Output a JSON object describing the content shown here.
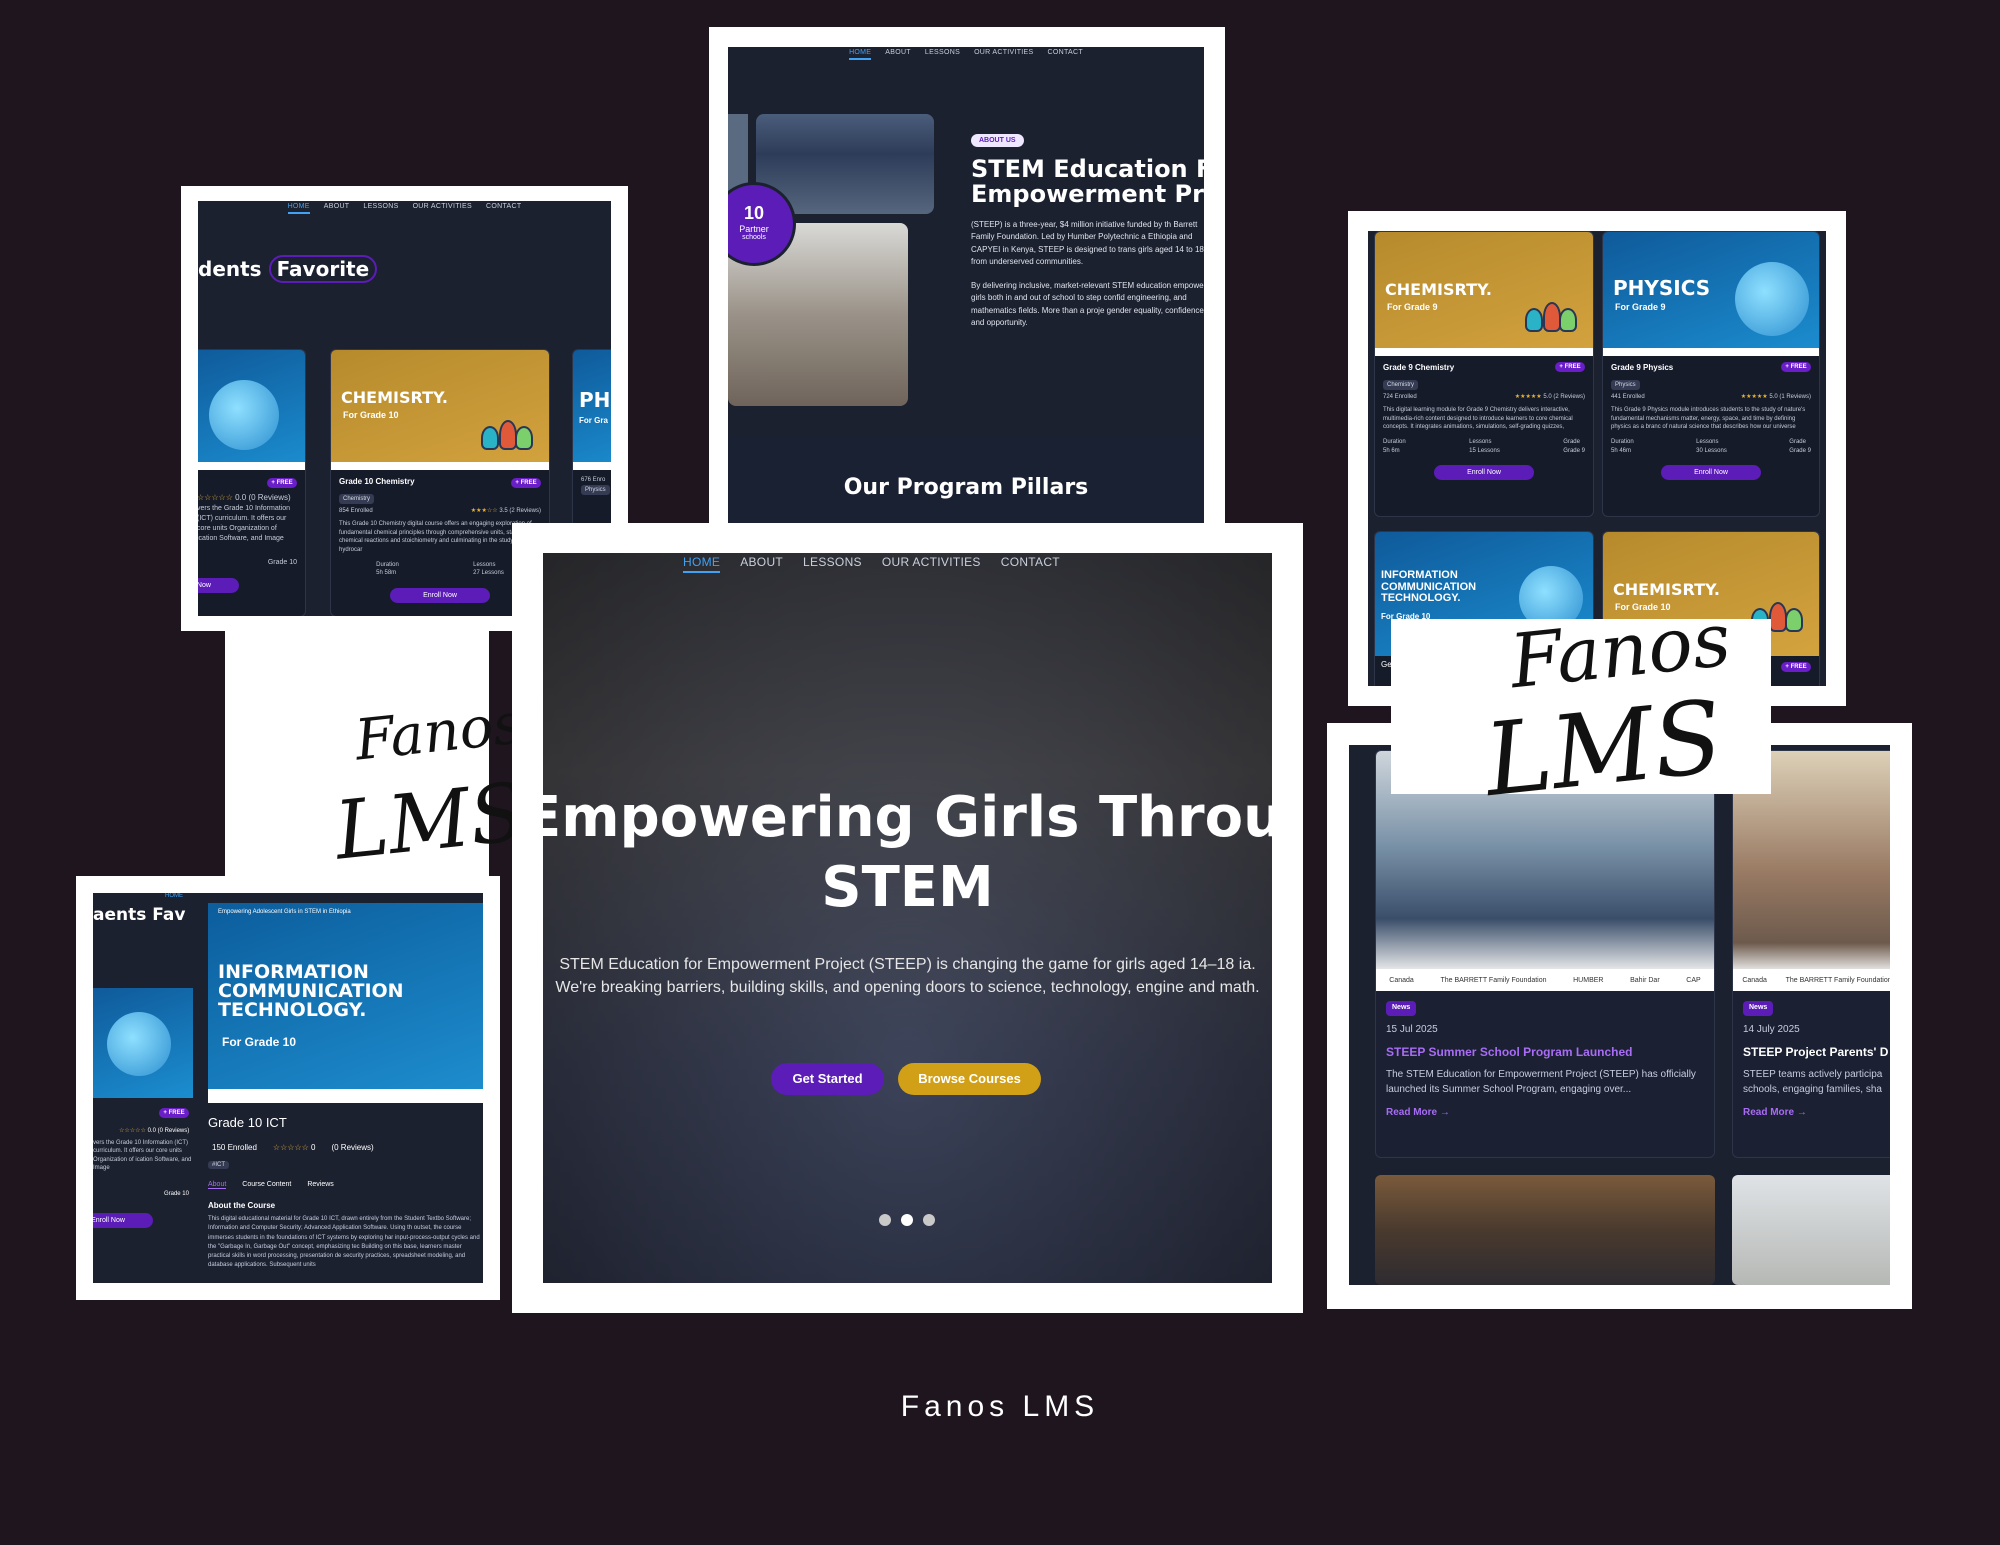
{
  "footer_title": "Fanos LMS",
  "signature": [
    "Fanos",
    "LMS"
  ],
  "nav": [
    "HOME",
    "ABOUT",
    "LESSONS",
    "OUR ACTIVITIES",
    "CONTACT"
  ],
  "hero": {
    "title_line1": "Empowering Girls Through",
    "title_line2": "STEM",
    "subtitle": "STEM Education for Empowerment Project (STEEP) is changing the game for girls aged 14–18 ia. We're breaking barriers, building skills, and opening doors to science, technology, engine and math.",
    "primary_button": "Get Started",
    "secondary_button": "Browse Courses"
  },
  "about": {
    "badge": "ABOUT US",
    "heading_line1": "STEM Education Fo",
    "heading_line2": "Empowerment Pro",
    "partner_number": "10",
    "partner_label": "Partner",
    "partner_sub": "schools",
    "para1": "(STEEP) is a three-year, $4 million initiative funded by th Barrett Family Foundation. Led by Humber Polytechnic a Ethiopia and CAPYEI in Kenya, STEEP is designed to trans girls aged 14 to 18 from underserved communities.",
    "para2": "By delivering inclusive, market-relevant STEM education empowers girls both in and out of school to step confid engineering, and mathematics fields. More than a proje gender equality, confidence, and opportunity.",
    "pillars": "Our Program Pillars"
  },
  "favorites": {
    "heading_a": "dents",
    "heading_b": "Favorite",
    "chem_title": "CHEMISRTY.",
    "chem_grade": "For Grade 10",
    "chem_name": "Grade 10 Chemistry",
    "chem_tag": "Chemistry",
    "chem_enrolled": "854 Enrolled",
    "chem_rating": "3.5 (2 Reviews)",
    "chem_desc": "This Grade 10 Chemistry digital course offers an engaging exploration of fundamental chemical principles through comprehensive units, starting with chemical reactions and stoichiometry and culminating in the study of hydrocar",
    "chem_duration": "5h 58m",
    "chem_lessons": "27 Lessons",
    "left_rating": "0.0 (0 Reviews)",
    "left_desc": "vers the Grade 10 Information (ICT) curriculum. It offers our core units Organization of ication Software, and Image",
    "left_grade": "Grade 10",
    "enroll": "Enroll Now",
    "free": "+ FREE",
    "duration_label": "Duration",
    "lessons_label": "Lessons",
    "grade_label": "Grade",
    "ph_short": "PH",
    "ph_grade": "For Gra",
    "ph_enrolled": "676 Enro",
    "ph_tag": "Physics"
  },
  "ict": {
    "tagline": "Empowering Adolescent Girls in STEM in Ethiopia",
    "title_line1": "INFORMATION",
    "title_line2": "COMMUNICATION",
    "title_line3": "TECHNOLOGY.",
    "grade": "For Grade 10",
    "course": "Grade 10 ICT",
    "enrolled": "150 Enrolled",
    "rating_value": "0",
    "reviews": "(0 Reviews)",
    "tag": "#ICT",
    "tab_about": "About",
    "tab_content": "Course Content",
    "tab_reviews": "Reviews",
    "about_heading": "About the Course",
    "about_text": "This digital educational material for Grade 10 ICT, drawn entirely from the Student Textbo Software; Information and Computer Security; Advanced Application Software. Using th outset, the course immerses students in the foundations of ICT systems by exploring har input-process-output cycles and the \"Garbage In, Garbage Out\" concept, emphasizing tec Building on this base, learners master practical skills in word processing, presentation de security practices, spreadsheet modeling, and database applications. Subsequent units",
    "left_heading": "aents",
    "left_heading_b": "Fav",
    "home": "HOME"
  },
  "right_courses": {
    "chem9_title": "CHEMISRTY.",
    "chem9_grade": "For Grade 9",
    "chem9_name": "Grade 9 Chemistry",
    "chem9_tag": "Chemistry",
    "chem9_enrolled": "724 Enrolled",
    "chem9_rating": "5.0 (2 Reviews)",
    "chem9_desc": "This digital learning module for Grade 9 Chemistry delivers interactive, multimedia-rich content designed to introduce learners to core chemical concepts. It integrates animations, simulations, self-grading quizzes,",
    "chem9_duration": "5h 6m",
    "chem9_lessons": "15 Lessons",
    "chem9_grade_value": "Grade 9",
    "phy_title": "PHYSICS",
    "phy_grade": "For Grade 9",
    "phy_name": "Grade 9 Physics",
    "phy_tag": "Physics",
    "phy_enrolled": "441 Enrolled",
    "phy_rating": "5.0 (1 Reviews)",
    "phy_desc": "This Grade 9 Physics module introduces students to the study of nature's fundamental mechanisms matter, energy, space, and time by defining physics as a branc of natural science that describes how our universe",
    "phy_duration": "5h 46m",
    "phy_lessons": "30 Lessons",
    "phy_grade_value": "Grade 9",
    "ict_title_1": "INFORMATION",
    "ict_title_2": "COMMUNICATION",
    "ict_title_3": "TECHNOLOGY.",
    "ict_grade": "For Grade 10",
    "chem10_title": "CHEMISRTY.",
    "chem10_grade": "For Grade 10",
    "ge_short": "Ge"
  },
  "news": {
    "badge": "News",
    "date1": "15 Jul 2025",
    "title1": "STEEP Summer School Program Launched",
    "text1": "The STEM Education for Empowerment Project (STEEP) has officially launched its Summer School Program, engaging over...",
    "date2": "14 July 2025",
    "title2": "STEEP Project Parents' D",
    "text2": "STEEP teams actively participa schools, engaging families, sha",
    "readmore": "Read More →",
    "logos": [
      "Canada",
      "The BARRETT Family Foundation",
      "HUMBER",
      "Bahir Dar",
      "CAP"
    ]
  },
  "colors": {
    "background": "#1e151e",
    "screen": "#1c2130",
    "accent_purple": "#5b1cb8",
    "accent_gold": "#d1a017",
    "nav_active": "#3fa2f5"
  }
}
